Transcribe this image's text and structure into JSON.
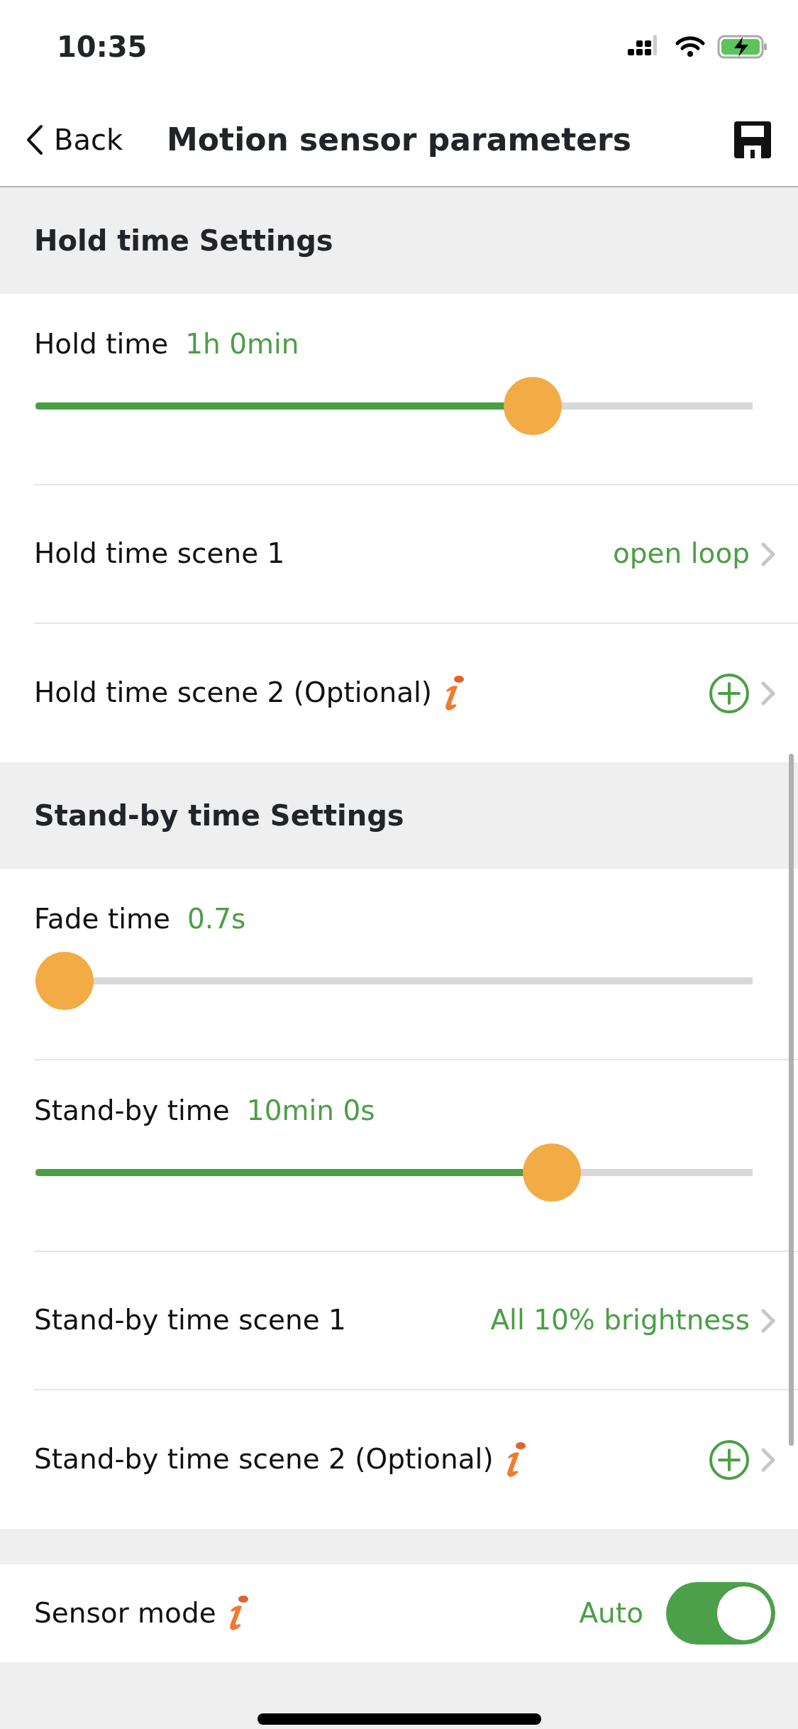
{
  "status_bar": {
    "time": "10:35"
  },
  "nav": {
    "back": "Back",
    "title": "Motion sensor parameters"
  },
  "sections": [
    {
      "title": "Hold time Settings",
      "rows": [
        {
          "kind": "slider",
          "label": "Hold time",
          "value": "1h 0min",
          "level": 0.71
        },
        {
          "kind": "link",
          "label": "Hold time scene 1",
          "value": "open loop"
        },
        {
          "kind": "optional",
          "label": "Hold time scene 2 (Optional)",
          "info": true
        }
      ]
    },
    {
      "title": "Stand-by time Settings",
      "rows": [
        {
          "kind": "slider",
          "label": "Fade time",
          "value": "0.7s",
          "level": 0
        },
        {
          "kind": "slider",
          "label": "Stand-by time",
          "value": "10min 0s",
          "level": 0.74
        },
        {
          "kind": "link",
          "label": "Stand-by time scene 1",
          "value": "All 10% brightness"
        },
        {
          "kind": "optional",
          "label": "Stand-by time scene 2 (Optional)",
          "info": true
        }
      ]
    },
    {
      "rows": [
        {
          "kind": "toggle",
          "label": "Sensor mode",
          "info": true,
          "value": "Auto",
          "on": true
        }
      ]
    }
  ]
}
